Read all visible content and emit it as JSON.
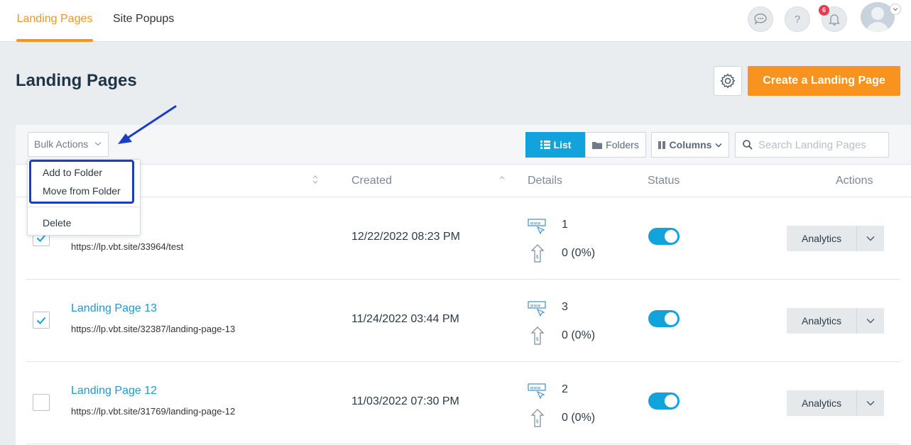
{
  "nav": {
    "tabs": [
      {
        "label": "Landing Pages",
        "active": true
      },
      {
        "label": "Site Popups",
        "active": false
      }
    ],
    "notification_count": "6",
    "help_glyph": "?"
  },
  "header": {
    "title": "Landing Pages",
    "create_button": "Create a Landing Page"
  },
  "toolbar": {
    "bulk_actions": "Bulk Actions",
    "view_list": "List",
    "view_folders": "Folders",
    "columns": "Columns",
    "search_placeholder": "Search Landing Pages"
  },
  "table": {
    "headers": {
      "created": "Created",
      "details": "Details",
      "status": "Status",
      "actions": "Actions"
    },
    "rows": [
      {
        "name": "",
        "url": "https://lp.vbt.site/33964/test",
        "created": "12/22/2022 08:23 PM",
        "views": "1",
        "conversions": "0 (0%)",
        "checked": true,
        "active": true,
        "action": "Analytics"
      },
      {
        "name": "Landing Page 13",
        "url": "https://lp.vbt.site/32387/landing-page-13",
        "created": "11/24/2022 03:44 PM",
        "views": "3",
        "conversions": "0 (0%)",
        "checked": true,
        "active": true,
        "action": "Analytics"
      },
      {
        "name": "Landing Page 12",
        "url": "https://lp.vbt.site/31769/landing-page-12",
        "created": "11/03/2022 07:30 PM",
        "views": "2",
        "conversions": "0 (0%)",
        "checked": false,
        "active": true,
        "action": "Analytics"
      }
    ]
  },
  "bulk_menu": {
    "items": [
      "Add to Folder",
      "Move from Folder",
      "Delete"
    ]
  },
  "colors": {
    "accent": "#f7931e",
    "primary": "#12a3dd",
    "annotation": "#1a3fc2"
  }
}
